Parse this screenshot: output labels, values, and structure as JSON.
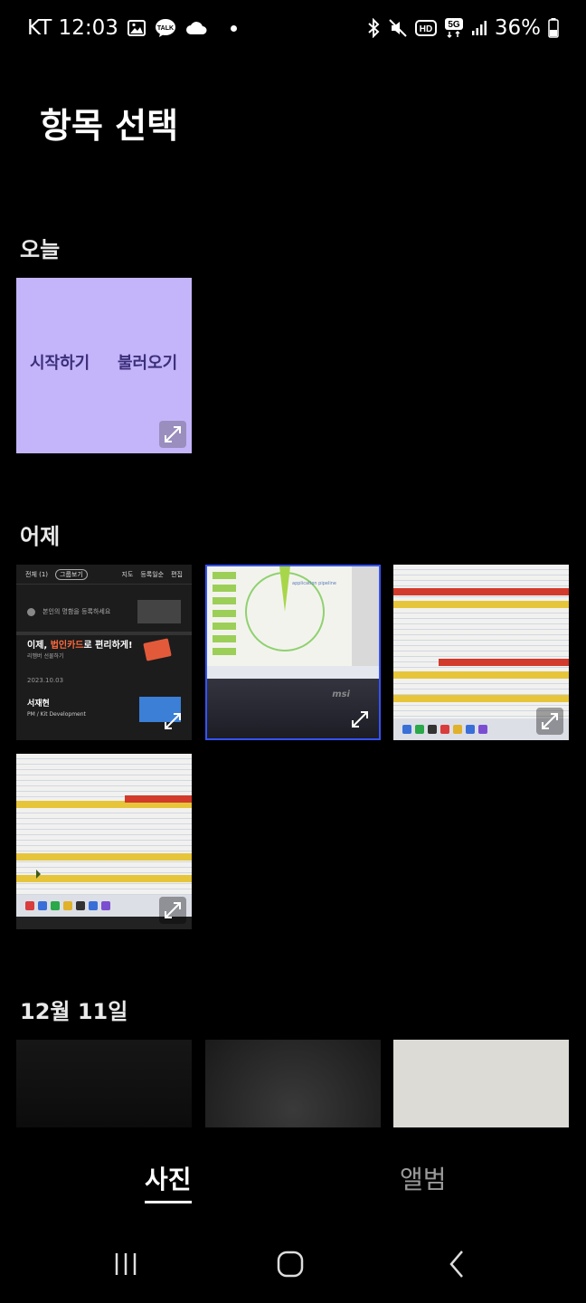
{
  "status_bar": {
    "carrier_time": "KT 12:03",
    "battery": "36%",
    "icons_left": [
      "gallery-icon",
      "kakaotalk-icon",
      "cloud-icon",
      "dot-icon"
    ],
    "icons_right": [
      "bluetooth-icon",
      "mute-icon",
      "hd-icon",
      "5g-icon",
      "signal-icon",
      "battery-icon"
    ]
  },
  "header": {
    "title": "항목 선택"
  },
  "sections": {
    "today": "오늘",
    "yesterday": "어제",
    "dec11": "12월 11일"
  },
  "today_tile": {
    "left_text": "시작하기",
    "right_text": "불러오기"
  },
  "app_tile": {
    "top_all": "전체 (1)",
    "top_pill": "그룹보기",
    "top_map": "지도",
    "top_order": "등록일순",
    "top_edit": "편집",
    "register_hint": "본인의 명함을 등록하세요",
    "banner_prefix": "이제, ",
    "banner_highlight": "법인카드",
    "banner_suffix": "로 편리하게!",
    "banner_sub": "리멤버 선물하기",
    "date": "2023.10.03",
    "card_name": "서재현",
    "card_role": "PM / Kit Development"
  },
  "laptop_tile": {
    "caption": "application pipeline",
    "brand": "msi"
  },
  "tabs": {
    "photos": "사진",
    "albums": "앨범"
  },
  "colors": {
    "background": "#000000",
    "kakao_purple": "#c4b5fb",
    "selected_border": "#3553ff"
  }
}
